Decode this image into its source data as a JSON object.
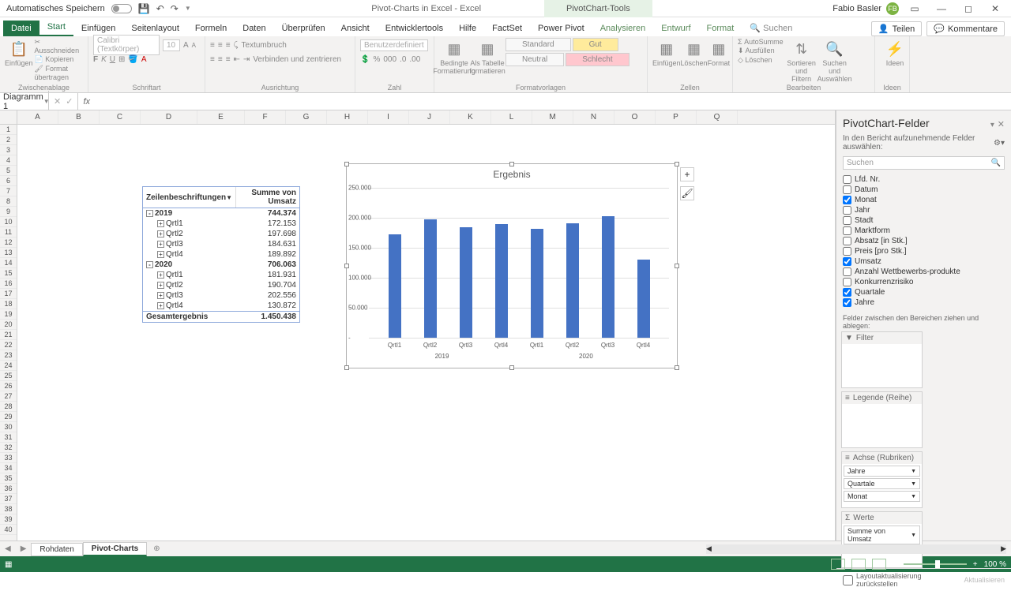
{
  "titlebar": {
    "autosave": "Automatisches Speichern",
    "docname": "Pivot-Charts in Excel - Excel",
    "context_tool": "PivotChart-Tools",
    "user": "Fabio Basler",
    "user_initials": "FB"
  },
  "tabs": {
    "file": "Datei",
    "start": "Start",
    "einfuegen": "Einfügen",
    "seitenlayout": "Seitenlayout",
    "formeln": "Formeln",
    "daten": "Daten",
    "ueberpruefen": "Überprüfen",
    "ansicht": "Ansicht",
    "entwickler": "Entwicklertools",
    "hilfe": "Hilfe",
    "factset": "FactSet",
    "powerpivot": "Power Pivot",
    "analysieren": "Analysieren",
    "entwurf": "Entwurf",
    "format": "Format",
    "suchen": "Suchen",
    "teilen": "Teilen",
    "kommentare": "Kommentare"
  },
  "ribbon": {
    "clipboard": {
      "paste": "Einfügen",
      "cut": "Ausschneiden",
      "copy": "Kopieren",
      "format_painter": "Format übertragen",
      "label": "Zwischenablage"
    },
    "font": {
      "name": "Calibri (Textkörper)",
      "size": "10",
      "label": "Schriftart"
    },
    "align": {
      "wrap": "Textumbruch",
      "merge": "Verbinden und zentrieren",
      "label": "Ausrichtung"
    },
    "number": {
      "format": "Benutzerdefiniert",
      "label": "Zahl"
    },
    "styles": {
      "cond": "Bedingte Formatierung",
      "table": "Als Tabelle formatieren",
      "standard": "Standard",
      "gut": "Gut",
      "neutral": "Neutral",
      "schlecht": "Schlecht",
      "label": "Formatvorlagen"
    },
    "cells": {
      "insert": "Einfügen",
      "delete": "Löschen",
      "format": "Format",
      "label": "Zellen"
    },
    "editing": {
      "autosum": "AutoSumme",
      "fill": "Ausfüllen",
      "clear": "Löschen",
      "sort": "Sortieren und Filtern",
      "find": "Suchen und Auswählen",
      "label": "Bearbeiten"
    },
    "ideas": {
      "btn": "Ideen",
      "label": "Ideen"
    }
  },
  "namebox": "Diagramm 1",
  "columns": [
    "A",
    "B",
    "C",
    "D",
    "E",
    "F",
    "G",
    "H",
    "I",
    "J",
    "K",
    "L",
    "M",
    "N",
    "O",
    "P",
    "Q"
  ],
  "pivot": {
    "h1": "Zeilenbeschriftungen",
    "h2": "Summe von Umsatz",
    "rows": [
      {
        "type": "group",
        "label": "2019",
        "value": "744.374",
        "toggle": "-"
      },
      {
        "type": "sub",
        "label": "Qrtl1",
        "value": "172.153",
        "toggle": "+"
      },
      {
        "type": "sub",
        "label": "Qrtl2",
        "value": "197.698",
        "toggle": "+"
      },
      {
        "type": "sub",
        "label": "Qrtl3",
        "value": "184.631",
        "toggle": "+"
      },
      {
        "type": "sub",
        "label": "Qrtl4",
        "value": "189.892",
        "toggle": "+"
      },
      {
        "type": "group",
        "label": "2020",
        "value": "706.063",
        "toggle": "-"
      },
      {
        "type": "sub",
        "label": "Qrtl1",
        "value": "181.931",
        "toggle": "+"
      },
      {
        "type": "sub",
        "label": "Qrtl2",
        "value": "190.704",
        "toggle": "+"
      },
      {
        "type": "sub",
        "label": "Qrtl3",
        "value": "202.556",
        "toggle": "+"
      },
      {
        "type": "sub",
        "label": "Qrtl4",
        "value": "130.872",
        "toggle": "+"
      }
    ],
    "total_label": "Gesamtergebnis",
    "total_value": "1.450.438"
  },
  "chart_data": {
    "type": "bar",
    "title": "Ergebnis",
    "ylabel": "",
    "ylim": [
      0,
      250000
    ],
    "y_ticks": [
      "250.000",
      "200.000",
      "150.000",
      "100.000",
      "50.000",
      "-"
    ],
    "categories": [
      "Qrtl1",
      "Qrtl2",
      "Qrtl3",
      "Qrtl4",
      "Qrtl1",
      "Qrtl2",
      "Qrtl3",
      "Qrtl4"
    ],
    "group_labels": [
      "2019",
      "2020"
    ],
    "values": [
      172153,
      197698,
      184631,
      189892,
      181931,
      190704,
      202556,
      130872
    ]
  },
  "fieldlist": {
    "title": "PivotChart-Felder",
    "sub": "In den Bericht aufzunehmende Felder auswählen:",
    "search": "Suchen",
    "fields": [
      {
        "name": "Lfd. Nr.",
        "checked": false
      },
      {
        "name": "Datum",
        "checked": false
      },
      {
        "name": "Monat",
        "checked": true
      },
      {
        "name": "Jahr",
        "checked": false
      },
      {
        "name": "Stadt",
        "checked": false
      },
      {
        "name": "Marktform",
        "checked": false
      },
      {
        "name": "Absatz [in Stk.]",
        "checked": false
      },
      {
        "name": "Preis [pro Stk.]",
        "checked": false
      },
      {
        "name": "Umsatz",
        "checked": true
      },
      {
        "name": "Anzahl Wettbewerbs-produkte",
        "checked": false
      },
      {
        "name": "Konkurrenzrisiko",
        "checked": false
      },
      {
        "name": "Quartale",
        "checked": true
      },
      {
        "name": "Jahre",
        "checked": true
      }
    ],
    "drag_label": "Felder zwischen den Bereichen ziehen und ablegen:",
    "zones": {
      "filter": "Filter",
      "legend": "Legende (Reihe)",
      "axis": "Achse (Rubriken)",
      "values": "Werte",
      "axis_chips": [
        "Jahre",
        "Quartale",
        "Monat"
      ],
      "values_chips": [
        "Summe von Umsatz"
      ]
    },
    "defer": "Layoutaktualisierung zurückstellen",
    "update": "Aktualisieren"
  },
  "sheets": {
    "s1": "Rohdaten",
    "s2": "Pivot-Charts"
  },
  "status": {
    "zoom": "100 %"
  }
}
